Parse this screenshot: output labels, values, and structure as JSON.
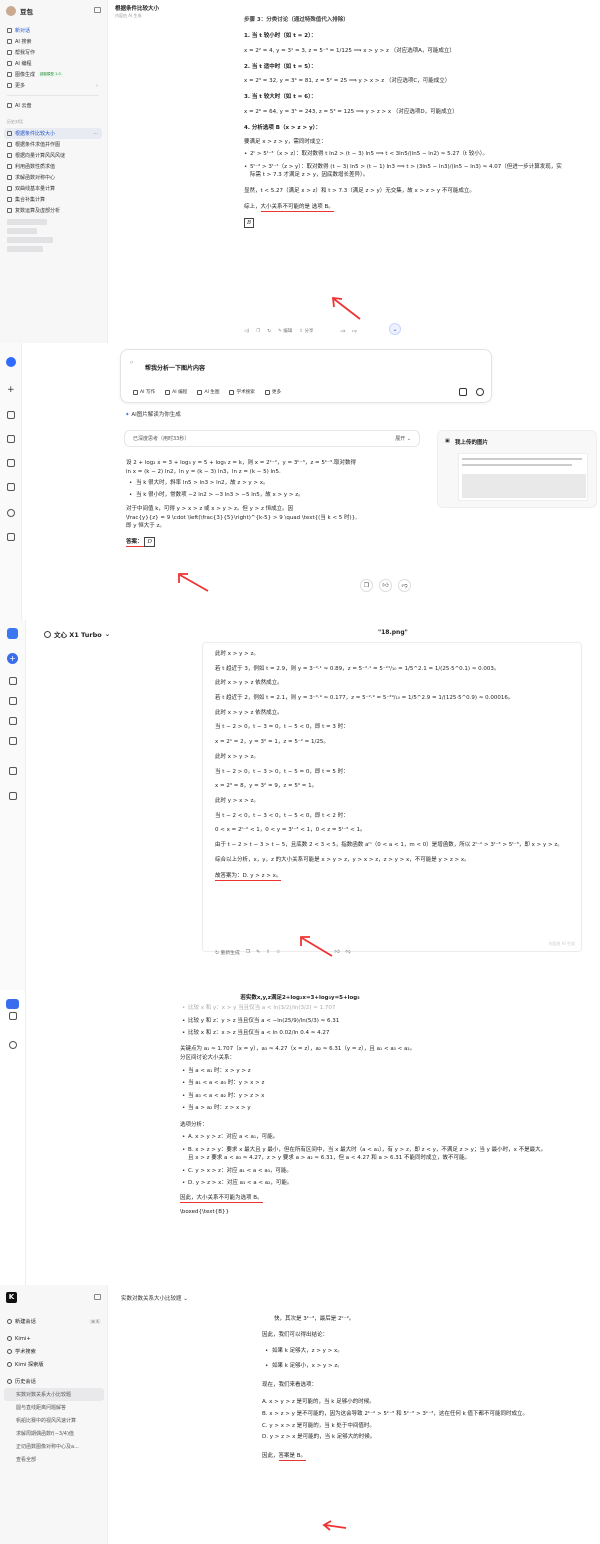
{
  "p1": {
    "app_name": "豆包",
    "chat_title": "根据条件比较大小",
    "chat_subtitle": "内容由 AI 生成",
    "sidebar": {
      "items": [
        {
          "label": "新对话",
          "icon": "chat-plus-icon"
        },
        {
          "label": "AI 搜索",
          "icon": "search-icon"
        },
        {
          "label": "帮我写作",
          "icon": "pen-icon"
        },
        {
          "label": "AI 编程",
          "icon": "code-icon"
        },
        {
          "label": "图像生成",
          "icon": "image-icon",
          "badge": "超能模型 1.0"
        },
        {
          "label": "更多",
          "icon": "grid-icon"
        },
        {
          "label": "AI 云盘",
          "icon": "cloud-icon"
        }
      ],
      "history_label": "历史对话",
      "history": [
        "根据条件比较大小",
        "根据条件求值并作图",
        "根据向量计算风风风谜",
        "利用函数性质求值",
        "求解函数对称中心",
        "双曲线基本量计算",
        "集合补集计算",
        "复数运算及虚部分析"
      ]
    },
    "content": {
      "step_heading": "步骤 3：分类讨论（通过特殊值代入排除）",
      "h1": "1. 当 t 较小时（如 t = 2）：",
      "eq1": "x = 2² = 4, y = 3¹ = 3, z = 5⁻³ = 1/125 ⟹ x > y > z （对应选项A，可能成立）",
      "h2": "2. 当 t 适中时（如 t = 5）：",
      "eq2": "x = 2⁵ = 32, y = 3⁴ = 81, z = 5² = 25 ⟹ y > x > z （对应选项C，可能成立）",
      "h3": "3. 当 t 较大时（如 t = 6）：",
      "eq3": "x = 2⁶ = 64, y = 3⁵ = 243, z = 5³ = 125 ⟹ y > z > x （对应选项D，可能成立）",
      "h4": "4. 分析选项 B（x > z > y）：",
      "need": "要满足 x > z > y，需同时成立：",
      "b1": "2ᵗ > 5ᵗ⁻³（x > z）：取对数得 t ln2 > (t − 3) ln5 ⟹ t < 3ln5/(ln5 − ln2) ≈ 5.27（t 较小）。",
      "b2": "5ᵗ⁻³ > 3ᵗ⁻¹（z > y）：取对数得 (t − 3) ln5 > (t − 1) ln3 ⟹ t > (3ln5 − ln3)/(ln5 − ln3) ≈ 4.07（但进一步计算发现，实际需 t > 7.3 才满足 z > y，因底数增长差异）。",
      "clear": "显然，t < 5.27（满足 x > z）和 t > 7.3（满足 z > y）无交集，故 x > z > y 不可能成立。",
      "conclusion_pre": "综上，",
      "conclusion": "大小关系不可能的是 选项 B。",
      "boxed": "B",
      "toolbar": [
        "编辑",
        "分享"
      ]
    }
  },
  "p2": {
    "prompt": "帮我分析一下图片内容",
    "tools": [
      "AI 写作",
      "AI 编程",
      "AI 生图",
      "学术搜索",
      "更多"
    ],
    "ai_image": "AI图片解读为你生成",
    "thinking": "已深度思考（用时33秒）",
    "expand": "展开",
    "answer_lines": [
      "设 2 + log₂ x = 3 + log₃ y = 5 + log₅ z = k，则 x = 2ᵏ⁻²，y = 3ᵏ⁻³，z = 5ᵏ⁻⁵.取对数得",
      "ln x = (k − 2) ln2，ln y = (k − 3) ln3，ln z = (k − 5) ln5."
    ],
    "bullets": [
      "当 k 很大时，斜率 ln5 > ln3 > ln2，故 z > y > x。",
      "当 k 很小时，常数项 −2 ln2 > −3 ln3 > −5 ln5，故 x > y > z。"
    ],
    "middle": [
      "对于中间值 k，可得 y > x > z 或 x > y > z。但 y > z 恒成立。因",
      "\\frac{y}{z} = 9 \\cdot \\left(\\frac{3}{5}\\right)^{k-5} > 9 \\quad \\text{(当 k < 5 时)},",
      "即 y 恒大于 z。"
    ],
    "answer_label": "答案：",
    "answer_value": "D",
    "uploaded_title": "我上传的图片"
  },
  "p3": {
    "model": "文心 X1 Turbo",
    "doc_name": "\"18.png\"",
    "lines": [
      "此时 x > y > z。",
      "若 t 趋近于 3，例如 t = 2.9，则 y = 3⁻⁰·¹ ≈ 0.89，z = 5⁻²·¹ = 5⁻²¹/₁₀ = 1/5^2.1 = 1/(25·5^0.1) ≈ 0.003。",
      "此时 x > y > z 依然成立。",
      "若 t 趋近于 2，例如 t = 2.1，则 y = 3⁻⁰·⁹ ≈ 0.177，z = 5⁻²·⁹ = 5⁻²⁹/₁₀ = 1/5^2.9 = 1/(125·5^0.9) ≈ 0.00016。",
      "此时 x > y > z 依然成立。",
      "当 t − 2 > 0，t − 3 = 0，t − 5 < 0，即 t = 3 时：",
      "x = 2¹ = 2，y = 3⁰ = 1，z = 5⁻² = 1/25。",
      "此时 x > y > z。",
      "当 t − 2 > 0，t − 3 > 0，t − 5 = 0，即 t = 5 时：",
      "x = 2³ = 8，y = 3² = 9，z = 5⁰ = 1。",
      "此时 y > x > z。",
      "当 t − 2 < 0，t − 3 < 0，t − 5 < 0，即 t < 2 时：",
      "0 < x = 2ᵗ⁻² < 1，0 < y = 3ᵗ⁻³ < 1，0 < z = 5ᵗ⁻⁵ < 1。",
      "由于 t − 2 > t − 3 > t − 5，且底数 2 < 3 < 5，指数函数 aᵐ（0 < a < 1，m < 0）是增函数，所以 2ᵗ⁻² > 3ᵗ⁻³ > 5ᵗ⁻⁵，即 x > y > z。",
      "综合以上分析，x，y，z 的大小关系可能是 x > y > z，y > x > z，z > y > x，不可能是 y > z > x。"
    ],
    "final": "故答案为：D. y > z > x。",
    "watermark": "内容由 AI 生成",
    "regen": "重新生成"
  },
  "p4": {
    "title": "若实数x,y,z满足2+log₂x=3+log₃y=5+log₅",
    "lines_top": [
      "比较 x 和 y：x > y 当且仅当 a < ln(3/2)/ln(3/2) ≈ 1.707",
      "比较 y 和 z：y > z 当且仅当 a < −ln(25/9)/ln(5/3) ≈ 6.31",
      "比较 x 和 z：x > z 当且仅当 a < ln 0.02/ln 0.4 ≈ 4.27"
    ],
    "key": "关键点为 a₁ ≈ 1.707（x = y），a₃ ≈ 4.27（x = z），a₂ ≈ 6.31（y = z），且 a₁ < a₃ < a₂。",
    "zone_head": "分区间讨论大小关系：",
    "zones": [
      "当 a < a₁ 时：x > y > z",
      "当 a₁ < a < a₃ 时：y > x > z",
      "当 a₃ < a < a₂ 时：y > z > x",
      "当 a > a₂ 时：z > x > y"
    ],
    "opt_head": "选项分析：",
    "opts": [
      "A. x > y > z：对应 a < a₁，可能。",
      "B. x > z > y：要求 x 最大且 y 最小，但在所有区间中，当 x 最大时（a < a₁），有 y > z，即 z < y，不满足 z > y；当 y 最小时，x 不是最大。且 x > z 要求 a < a₃ ≈ 4.27，z > y 要求 a > a₂ ≈ 6.31，但 a < 4.27 和 a > 6.31 不能同时成立，故不可能。",
      "C. y > x > z：对应 a₁ < a < a₃，可能。",
      "D. y > z > x：对应 a₃ < a < a₂，可能。"
    ],
    "final": "因此，大小关系不可能为选项 B。",
    "boxed": "\\boxed{\\text{B}}"
  },
  "p5": {
    "convtitle": "实数对数关系大小比较题",
    "sidebar": {
      "new_chat": "新建会话",
      "shortcut": "⌘ K",
      "items": [
        "Kimi+",
        "学术搜索",
        "Kimi 探索版",
        "历史会话"
      ],
      "history": [
        "实数对数关系大小比较题",
        "圆与直线距离问题解答",
        "帆船比赛中的视风风速计算",
        "求解周期偶函数f(−3/4)值",
        "正切函数图像对称中心及a...",
        "查看全部"
      ]
    },
    "lines": [
      "快，其次是 3ᵏ⁻³，最后是 2ᵏ⁻²。",
      "因此，我们可以得出结论：",
      "如果 k 足够大，z > y > x。",
      "如果 k 足够小，x > y > z。",
      "现在，我们来看选项：",
      "A. x > y > z 是可能的，当 k 足够小的时候。",
      "B. x > z > y 是不可能的，因为这会导致 2ᵏ⁻² > 5ᵏ⁻⁵ 和 5ᵏ⁻⁵ > 3ᵏ⁻³，这在任何 k 值下都不可能同时成立。",
      "C. y > x > z 是可能的，当 k 处于中间值时。",
      "D. y > z > x 是可能的，当 k 足够大的时候。"
    ],
    "final_pre": "因此，",
    "final": "答案是 B。"
  }
}
